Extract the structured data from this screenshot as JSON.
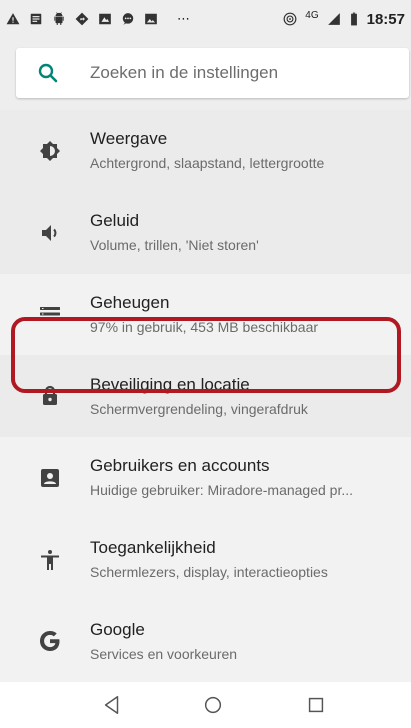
{
  "status_bar": {
    "network_badge": "4G",
    "time": "18:57",
    "dots": "⋯",
    "left_icons": [
      "warning-icon",
      "notes-icon",
      "android-icon",
      "maps-icon",
      "screenshot-icon",
      "chat-icon",
      "image-icon"
    ],
    "right_icons": [
      "hotspot-icon",
      "signal-icon",
      "battery-icon"
    ]
  },
  "search": {
    "placeholder": "Zoeken in de instellingen",
    "icon": "search-icon",
    "accent": "#008577"
  },
  "settings": [
    {
      "title": "Weergave",
      "subtitle": "Achtergrond, slaapstand, lettergrootte",
      "icon": "brightness-icon"
    },
    {
      "title": "Geluid",
      "subtitle": "Volume, trillen, 'Niet storen'",
      "icon": "volume-icon"
    },
    {
      "title": "Geheugen",
      "subtitle": "97% in gebruik, 453 MB beschikbaar",
      "icon": "storage-icon"
    },
    {
      "title": "Beveiliging en locatie",
      "subtitle": "Schermvergrendeling, vingerafdruk",
      "icon": "lock-icon"
    },
    {
      "title": "Gebruikers en accounts",
      "subtitle": "Huidige gebruiker: Miradore-managed pr...",
      "icon": "account-box-icon",
      "highlighted": true
    },
    {
      "title": "Toegankelijkheid",
      "subtitle": "Schermlezers, display, interactieopties",
      "icon": "accessibility-icon"
    },
    {
      "title": "Google",
      "subtitle": "Services en voorkeuren",
      "icon": "google-icon"
    }
  ],
  "nav": {
    "buttons": [
      "back-icon",
      "home-icon",
      "recents-icon"
    ]
  },
  "colors": {
    "highlight": "#b01822",
    "icon": "#424242",
    "background": "#f2f2f2"
  }
}
